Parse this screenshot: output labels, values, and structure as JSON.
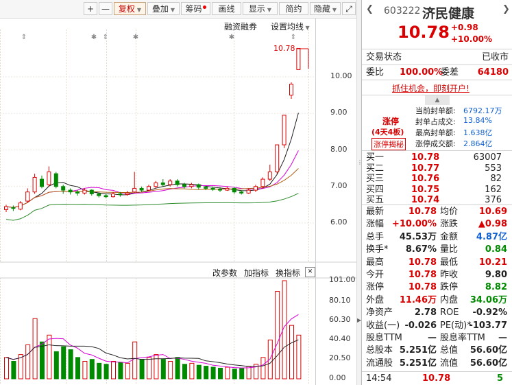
{
  "toolbar": {
    "plus": "+",
    "minus": "—",
    "fuquan": "复权",
    "diejia": "叠加",
    "chouma": "筹码",
    "huaxian": "画线",
    "xianshi": "显示",
    "jianyue": "简约",
    "yincang": "隐藏",
    "expand": "⤢"
  },
  "chart": {
    "rzrq": "融资融券",
    "settings": "设置均线",
    "last_price_tag": "10.78",
    "price_ticks": [
      "10.00",
      "9.00",
      "8.00",
      "7.00",
      "6.00"
    ],
    "indicator_buttons": [
      "改参数",
      "加指标",
      "换指标"
    ],
    "close_icon": "✕",
    "vol_ticks": [
      "101.00",
      "80.10",
      "60.30",
      "40.40",
      "20.50",
      "0.00"
    ]
  },
  "chart_data": {
    "type": "candlestick",
    "y_range": [
      5.6,
      11.2
    ],
    "candles": [
      {
        "o": 6.37,
        "c": 6.45,
        "h": 6.5,
        "l": 6.3
      },
      {
        "o": 6.42,
        "c": 6.4,
        "h": 6.48,
        "l": 6.33
      },
      {
        "o": 6.38,
        "c": 6.55,
        "h": 6.6,
        "l": 6.35
      },
      {
        "o": 6.6,
        "c": 6.85,
        "h": 6.95,
        "l": 6.55
      },
      {
        "o": 6.85,
        "c": 7.25,
        "h": 7.35,
        "l": 6.8
      },
      {
        "o": 7.2,
        "c": 7.0,
        "h": 7.3,
        "l": 6.95
      },
      {
        "o": 7.05,
        "c": 7.4,
        "h": 7.55,
        "l": 7.0
      },
      {
        "o": 7.35,
        "c": 7.0,
        "h": 7.4,
        "l": 6.95
      },
      {
        "o": 7.0,
        "c": 6.9,
        "h": 7.05,
        "l": 6.8
      },
      {
        "o": 6.9,
        "c": 6.85,
        "h": 6.95,
        "l": 6.78
      },
      {
        "o": 6.85,
        "c": 6.82,
        "h": 6.9,
        "l": 6.75
      },
      {
        "o": 6.82,
        "c": 6.9,
        "h": 6.95,
        "l": 6.78
      },
      {
        "o": 6.9,
        "c": 6.8,
        "h": 6.92,
        "l": 6.75
      },
      {
        "o": 6.8,
        "c": 6.75,
        "h": 6.82,
        "l": 6.7
      },
      {
        "o": 6.75,
        "c": 6.72,
        "h": 6.8,
        "l": 6.68
      },
      {
        "o": 6.72,
        "c": 6.8,
        "h": 6.85,
        "l": 6.7
      },
      {
        "o": 6.8,
        "c": 6.78,
        "h": 6.85,
        "l": 6.72
      },
      {
        "o": 6.78,
        "c": 6.82,
        "h": 6.88,
        "l": 6.75
      },
      {
        "o": 6.85,
        "c": 6.95,
        "h": 7.4,
        "l": 6.82
      },
      {
        "o": 6.95,
        "c": 6.9,
        "h": 7.0,
        "l": 6.85
      },
      {
        "o": 6.9,
        "c": 7.0,
        "h": 7.05,
        "l": 6.88
      },
      {
        "o": 7.0,
        "c": 7.1,
        "h": 7.15,
        "l": 6.95
      },
      {
        "o": 7.1,
        "c": 7.05,
        "h": 7.2,
        "l": 7.0
      },
      {
        "o": 7.05,
        "c": 7.15,
        "h": 7.2,
        "l": 7.0
      },
      {
        "o": 7.15,
        "c": 7.05,
        "h": 7.2,
        "l": 7.0
      },
      {
        "o": 7.05,
        "c": 7.0,
        "h": 7.1,
        "l": 6.95
      },
      {
        "o": 7.0,
        "c": 7.05,
        "h": 7.1,
        "l": 6.95
      },
      {
        "o": 7.05,
        "c": 6.98,
        "h": 7.08,
        "l": 6.92
      },
      {
        "o": 6.98,
        "c": 6.95,
        "h": 7.02,
        "l": 6.9
      },
      {
        "o": 6.95,
        "c": 6.92,
        "h": 7.0,
        "l": 6.88
      },
      {
        "o": 6.92,
        "c": 6.9,
        "h": 6.98,
        "l": 6.85
      },
      {
        "o": 6.9,
        "c": 6.95,
        "h": 7.0,
        "l": 6.88
      },
      {
        "o": 6.95,
        "c": 6.85,
        "h": 6.98,
        "l": 6.8
      },
      {
        "o": 6.85,
        "c": 6.82,
        "h": 6.9,
        "l": 6.78
      },
      {
        "o": 6.82,
        "c": 6.9,
        "h": 6.95,
        "l": 6.8
      },
      {
        "o": 6.9,
        "c": 7.0,
        "h": 7.05,
        "l": 6.85
      },
      {
        "o": 7.0,
        "c": 7.2,
        "h": 7.25,
        "l": 6.95
      },
      {
        "o": 7.2,
        "c": 7.4,
        "h": 7.6,
        "l": 7.15
      },
      {
        "o": 7.4,
        "c": 8.14,
        "h": 8.14,
        "l": 7.35
      },
      {
        "o": 8.14,
        "c": 8.95,
        "h": 8.95,
        "l": 8.05
      },
      {
        "o": 9.5,
        "c": 9.8,
        "h": 9.85,
        "l": 9.4
      },
      {
        "o": 10.2,
        "c": 10.78,
        "h": 10.78,
        "l": 10.2
      }
    ],
    "volume_range": [
      0,
      101
    ],
    "volumes": [
      22,
      18,
      25,
      35,
      62,
      38,
      45,
      28,
      33,
      30,
      22,
      18,
      20,
      16,
      15,
      18,
      17,
      16,
      38,
      20,
      22,
      25,
      20,
      18,
      22,
      15,
      16,
      14,
      13,
      12,
      11,
      12,
      10,
      11,
      13,
      15,
      22,
      40,
      90,
      101,
      55,
      45
    ]
  },
  "panel": {
    "code": "603222",
    "name": "济民健康",
    "price": "10.78",
    "change": "+0.98",
    "change_pct": "+10.00%",
    "trade_status_label": "交易状态",
    "trade_status_value": "已收市",
    "weibi_label": "委比",
    "weibi_value": "100.00%",
    "weicha_label": "委差",
    "weicha_value": "64180",
    "promo": "抓住机会，即刻开户!",
    "zt_title": "涨停",
    "zt_sub": "(4天4板)",
    "zt_btn": "涨停揭秘",
    "zt_rows": [
      {
        "label": "当前封单额:",
        "value": "6792.17万"
      },
      {
        "label": "封单占成交:",
        "value": "13.84%"
      },
      {
        "label": "最高封单额:",
        "value": "1.638亿"
      },
      {
        "label": "涨停成交额:",
        "value": "2.864亿"
      }
    ],
    "bids": [
      {
        "label": "买一",
        "price": "10.78",
        "vol": "63007"
      },
      {
        "label": "买二",
        "price": "10.77",
        "vol": "553"
      },
      {
        "label": "买三",
        "price": "10.76",
        "vol": "82"
      },
      {
        "label": "买四",
        "price": "10.75",
        "vol": "162"
      },
      {
        "label": "买五",
        "price": "10.74",
        "vol": "376"
      }
    ],
    "stats": [
      {
        "l1": "最新",
        "v1": "10.78",
        "c1": "red",
        "l2": "均价",
        "v2": "10.69",
        "c2": "red"
      },
      {
        "l1": "涨幅",
        "v1": "+10.00%",
        "c1": "red",
        "l2": "涨跌",
        "v2": "▲0.98",
        "c2": "red"
      },
      {
        "l1": "总手",
        "v1": "45.53万",
        "c1": "dark",
        "l2": "金额",
        "v2": "4.87亿",
        "c2": "blue"
      },
      {
        "l1": "换手*",
        "v1": "8.67%",
        "c1": "dark",
        "l2": "量比",
        "v2": "0.84",
        "c2": "green"
      },
      {
        "l1": "最高",
        "v1": "10.78",
        "c1": "red",
        "l2": "最低",
        "v2": "10.21",
        "c2": "red"
      },
      {
        "l1": "今开",
        "v1": "10.78",
        "c1": "red",
        "l2": "昨收",
        "v2": "9.80",
        "c2": "dark"
      },
      {
        "l1": "涨停",
        "v1": "10.78",
        "c1": "red",
        "l2": "跌停",
        "v2": "8.82",
        "c2": "green"
      },
      {
        "l1": "外盘",
        "v1": "11.46万",
        "c1": "red",
        "l2": "内盘",
        "v2": "34.06万",
        "c2": "green"
      },
      {
        "l1": "净资产",
        "v1": "2.78",
        "c1": "dark",
        "l2": "ROE",
        "v2": "-0.92%",
        "c2": "dark"
      },
      {
        "l1": "收益(一)",
        "v1": "-0.026",
        "c1": "dark",
        "l2": "PE(动)*",
        "v2": "-103.77",
        "c2": "dark"
      },
      {
        "l1": "股息TTM",
        "v1": "—",
        "c1": "dark",
        "l2": "股息率TTM",
        "v2": "—",
        "c2": "dark"
      },
      {
        "l1": "总股本",
        "v1": "5.251亿",
        "c1": "dark",
        "l2": "总值",
        "v2": "56.60亿",
        "c2": "dark"
      },
      {
        "l1": "流通股",
        "v1": "5.251亿",
        "c1": "dark",
        "l2": "流值",
        "v2": "56.60亿",
        "c2": "dark"
      }
    ],
    "tick_time": "14:54",
    "tick_price": "10.78",
    "tick_vol": "5"
  },
  "colors": {
    "up": "#d80000",
    "down": "#008a00",
    "ma5": "#1a1a1a",
    "ma10": "#d400d4",
    "ma20": "#b06010",
    "ma60": "#2a8a2a"
  }
}
